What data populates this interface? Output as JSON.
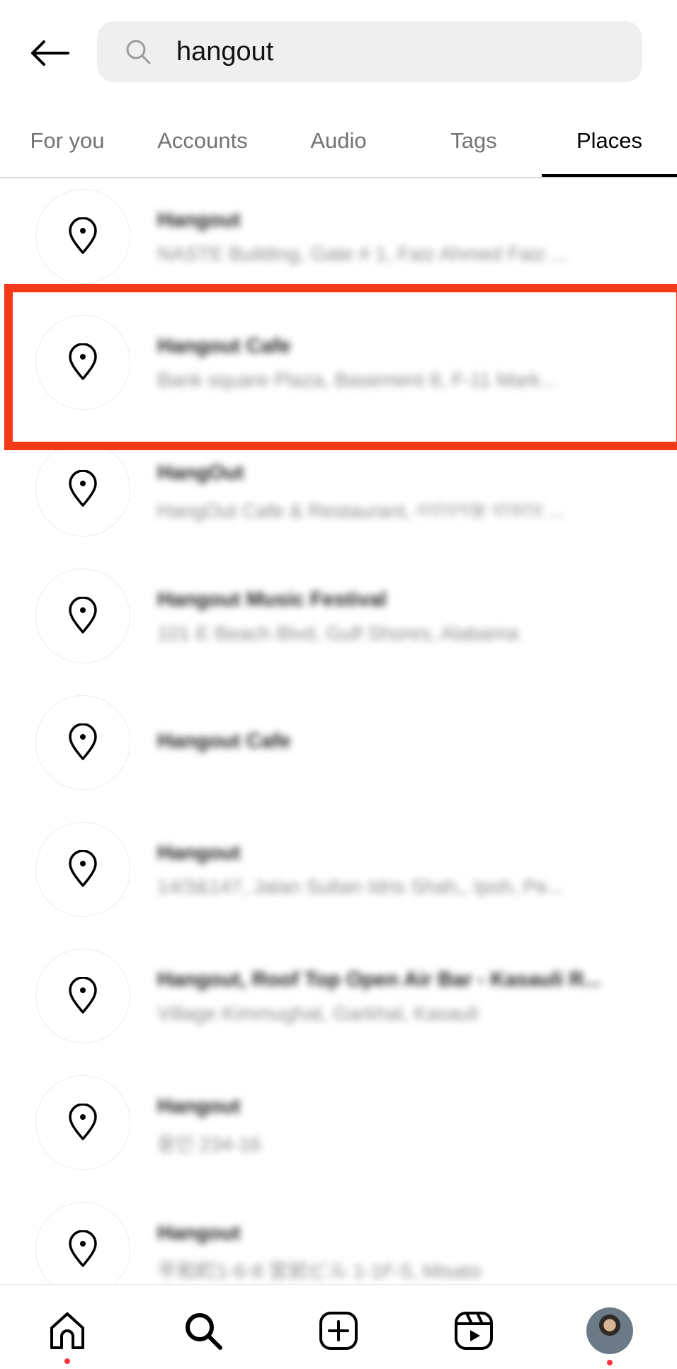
{
  "search": {
    "value": "hangout",
    "back_icon": "arrow-left-icon",
    "search_icon": "magnifier-icon"
  },
  "tabs": [
    {
      "label": "For you",
      "active": false
    },
    {
      "label": "Accounts",
      "active": false
    },
    {
      "label": "Audio",
      "active": false
    },
    {
      "label": "Tags",
      "active": false
    },
    {
      "label": "Places",
      "active": true
    }
  ],
  "places": [
    {
      "title": "Hangout",
      "subtitle": "NASTE Building, Gate # 1, Faiz Ahmed Faiz ..."
    },
    {
      "title": "Hangout Cafe",
      "subtitle": "Bank square Plaza, Basement 8, F-11 Mark..."
    },
    {
      "title": "HangOut",
      "subtitle": "HangOut Cafe & Restaurant, নবাবগঞ্জ বাজার ..."
    },
    {
      "title": "Hangout Music Festival",
      "subtitle": "101 E Beach Blvd, Gulf Shores, Alabama"
    },
    {
      "title": "Hangout Cafe",
      "subtitle": ""
    },
    {
      "title": "Hangout",
      "subtitle": "14/3&147, Jalan Sultan Idris Shah,, Ipoh, Pe..."
    },
    {
      "title": "Hangout, Roof Top Open Air Bar - Kasauli R...",
      "subtitle": "Village Kimmughat, Garkhal, Kasauli"
    },
    {
      "title": "Hangout",
      "subtitle": "용인 234-16"
    },
    {
      "title": "Hangout",
      "subtitle": "平和町1-6-8 宮前ビル 1-1F-5, Misato"
    }
  ],
  "highlight": {
    "color": "#f23a16",
    "row_index": 1
  },
  "bottom_nav": [
    {
      "name": "home",
      "icon": "home-icon",
      "notification_dot": true
    },
    {
      "name": "search",
      "icon": "search-icon",
      "notification_dot": false,
      "active": true
    },
    {
      "name": "create",
      "icon": "plus-square-icon",
      "notification_dot": false
    },
    {
      "name": "reels",
      "icon": "reels-icon",
      "notification_dot": false
    },
    {
      "name": "profile",
      "icon": "avatar",
      "notification_dot": true
    }
  ],
  "colors": {
    "accent_dot": "#ff3040",
    "search_bg": "#efefef",
    "inactive_tab": "#737373"
  }
}
